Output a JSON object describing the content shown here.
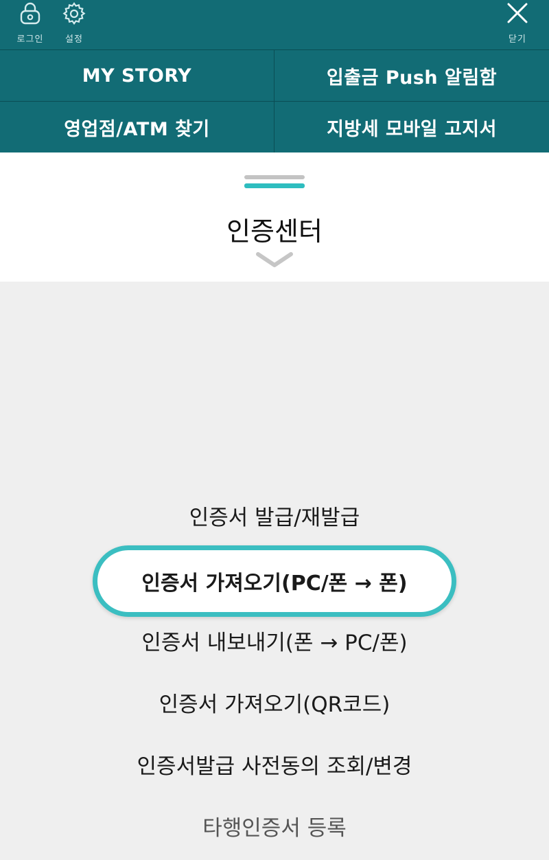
{
  "topbar": {
    "login_label": "로그인",
    "settings_label": "설정",
    "close_label": "닫기",
    "icons": {
      "login": "lock-icon",
      "settings": "gear-icon",
      "close": "close-icon"
    }
  },
  "quick_menu": {
    "items": [
      {
        "label": "MY STORY"
      },
      {
        "label": "입출금 Push 알림함"
      },
      {
        "label": "영업점/ATM 찾기"
      },
      {
        "label": "지방세 모바일 고지서"
      }
    ]
  },
  "sheet": {
    "title": "인증센터"
  },
  "menu": {
    "items": [
      {
        "label": "인증서 발급/재발급"
      },
      {
        "label": "인증서 가져오기(PC/폰 → 폰)",
        "selected": true
      },
      {
        "label": "인증서 내보내기(폰 → PC/폰)"
      },
      {
        "label": "인증서 가져오기(QR코드)"
      },
      {
        "label": "인증서발급 사전동의 조회/변경"
      },
      {
        "label": "타행인증서 등록"
      }
    ]
  },
  "colors": {
    "header_bg": "#126c75",
    "accent": "#3bbec1",
    "sheet_bg": "#ffffff",
    "page_bg": "#efefef"
  }
}
